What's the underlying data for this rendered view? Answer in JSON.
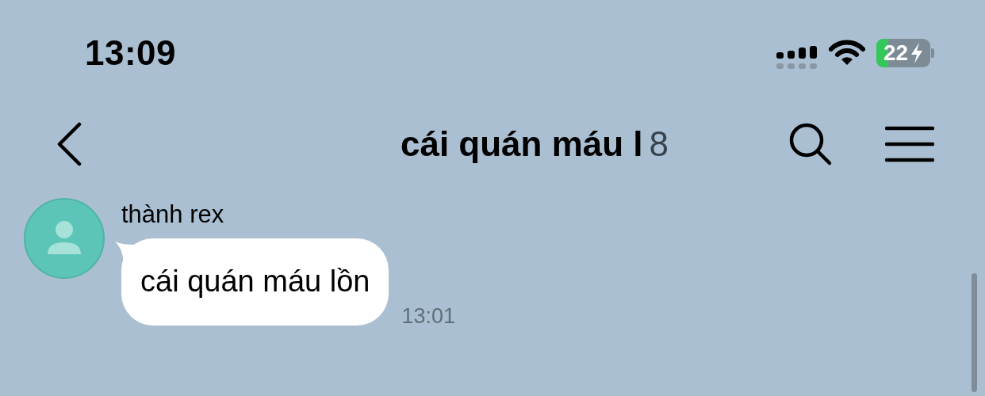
{
  "status_bar": {
    "time": "13:09",
    "battery": "22"
  },
  "header": {
    "title": "cái quán máu l",
    "member_count": "8"
  },
  "messages": [
    {
      "sender": "thành rex",
      "text": "cái quán máu lồn",
      "time": "13:01"
    }
  ]
}
